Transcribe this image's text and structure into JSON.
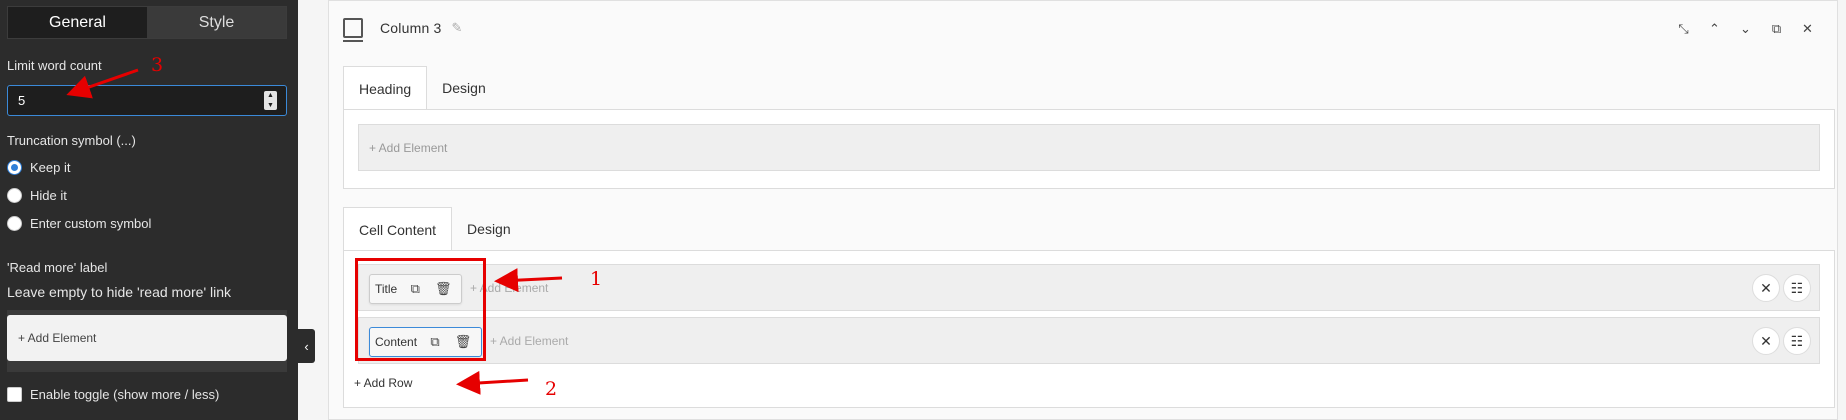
{
  "sidebar": {
    "tabs": [
      {
        "label": "General",
        "active": true
      },
      {
        "label": "Style",
        "active": false
      }
    ],
    "limit_word_count": {
      "label": "Limit word count",
      "value": "5"
    },
    "truncation": {
      "label": "Truncation symbol (...)",
      "options": [
        {
          "label": "Keep it",
          "checked": true
        },
        {
          "label": "Hide it",
          "checked": false
        },
        {
          "label": "Enter custom symbol",
          "checked": false
        }
      ]
    },
    "read_more": {
      "label": "'Read more' label",
      "hint": "Leave empty to hide 'read more' link",
      "add_element": "+ Add Element"
    },
    "toggle": {
      "label": "Enable toggle (show more / less)",
      "checked": false
    }
  },
  "column": {
    "title": "Column  3",
    "controls": [
      "collapse-icon",
      "chevron-up-icon",
      "chevron-down-icon",
      "duplicate-icon",
      "close-icon"
    ]
  },
  "heading_section": {
    "tabs": [
      {
        "label": "Heading",
        "active": true
      },
      {
        "label": "Design",
        "active": false
      }
    ],
    "add_element": "+ Add Element"
  },
  "cell_section": {
    "tabs": [
      {
        "label": "Cell Content",
        "active": true
      },
      {
        "label": "Design",
        "active": false
      }
    ],
    "rows": [
      {
        "chip": "Title",
        "add_element": "+ Add Element"
      },
      {
        "chip": "Content",
        "add_element": "+ Add Element"
      }
    ],
    "add_row": "+ Add Row"
  },
  "annotations": {
    "one": "1",
    "two": "2",
    "three": "3"
  },
  "colors": {
    "accent": "#2f7fd8",
    "annotation": "#e60000",
    "sidebar_bg": "#2c2c2c"
  }
}
